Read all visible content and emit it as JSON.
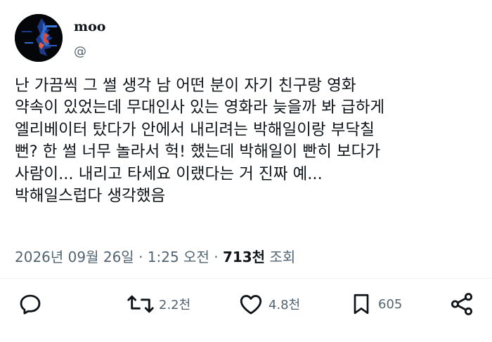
{
  "user": {
    "display_name": "moo",
    "handle": "@",
    "avatar_icon": "avatar-icon"
  },
  "tweet": {
    "lines": [
      "난 가끔씩 그 썰 생각 남 어떤 분이 자기 친구랑 영화",
      "약속이 있었는데 무대인사 있는 영화라 늦을까 봐 급하게",
      "엘리베이터 탔다가 안에서 내리려는 박해일이랑 부닥칠",
      "뻔? 한 썰 너무 놀라서 헉! 했는데 박해일이 빤히 보다가",
      "사람이... 내리고 타세요 이랬다는 거 진짜 예...",
      "박해일스럽다 생각했음"
    ]
  },
  "meta": {
    "timestamp": "2026년 09월 26일 · 1:25 오전 ·",
    "views_count": "713천",
    "views_label": "조회"
  },
  "actions": {
    "reply": {
      "icon": "reply-icon"
    },
    "retweet": {
      "icon": "retweet-icon",
      "count": "2.2천"
    },
    "like": {
      "icon": "heart-icon",
      "count": "4.8천"
    },
    "bookmark": {
      "icon": "bookmark-icon",
      "count": "605"
    },
    "share": {
      "icon": "share-icon"
    }
  },
  "colors": {
    "text": "#0f1419",
    "secondary": "#536471"
  }
}
